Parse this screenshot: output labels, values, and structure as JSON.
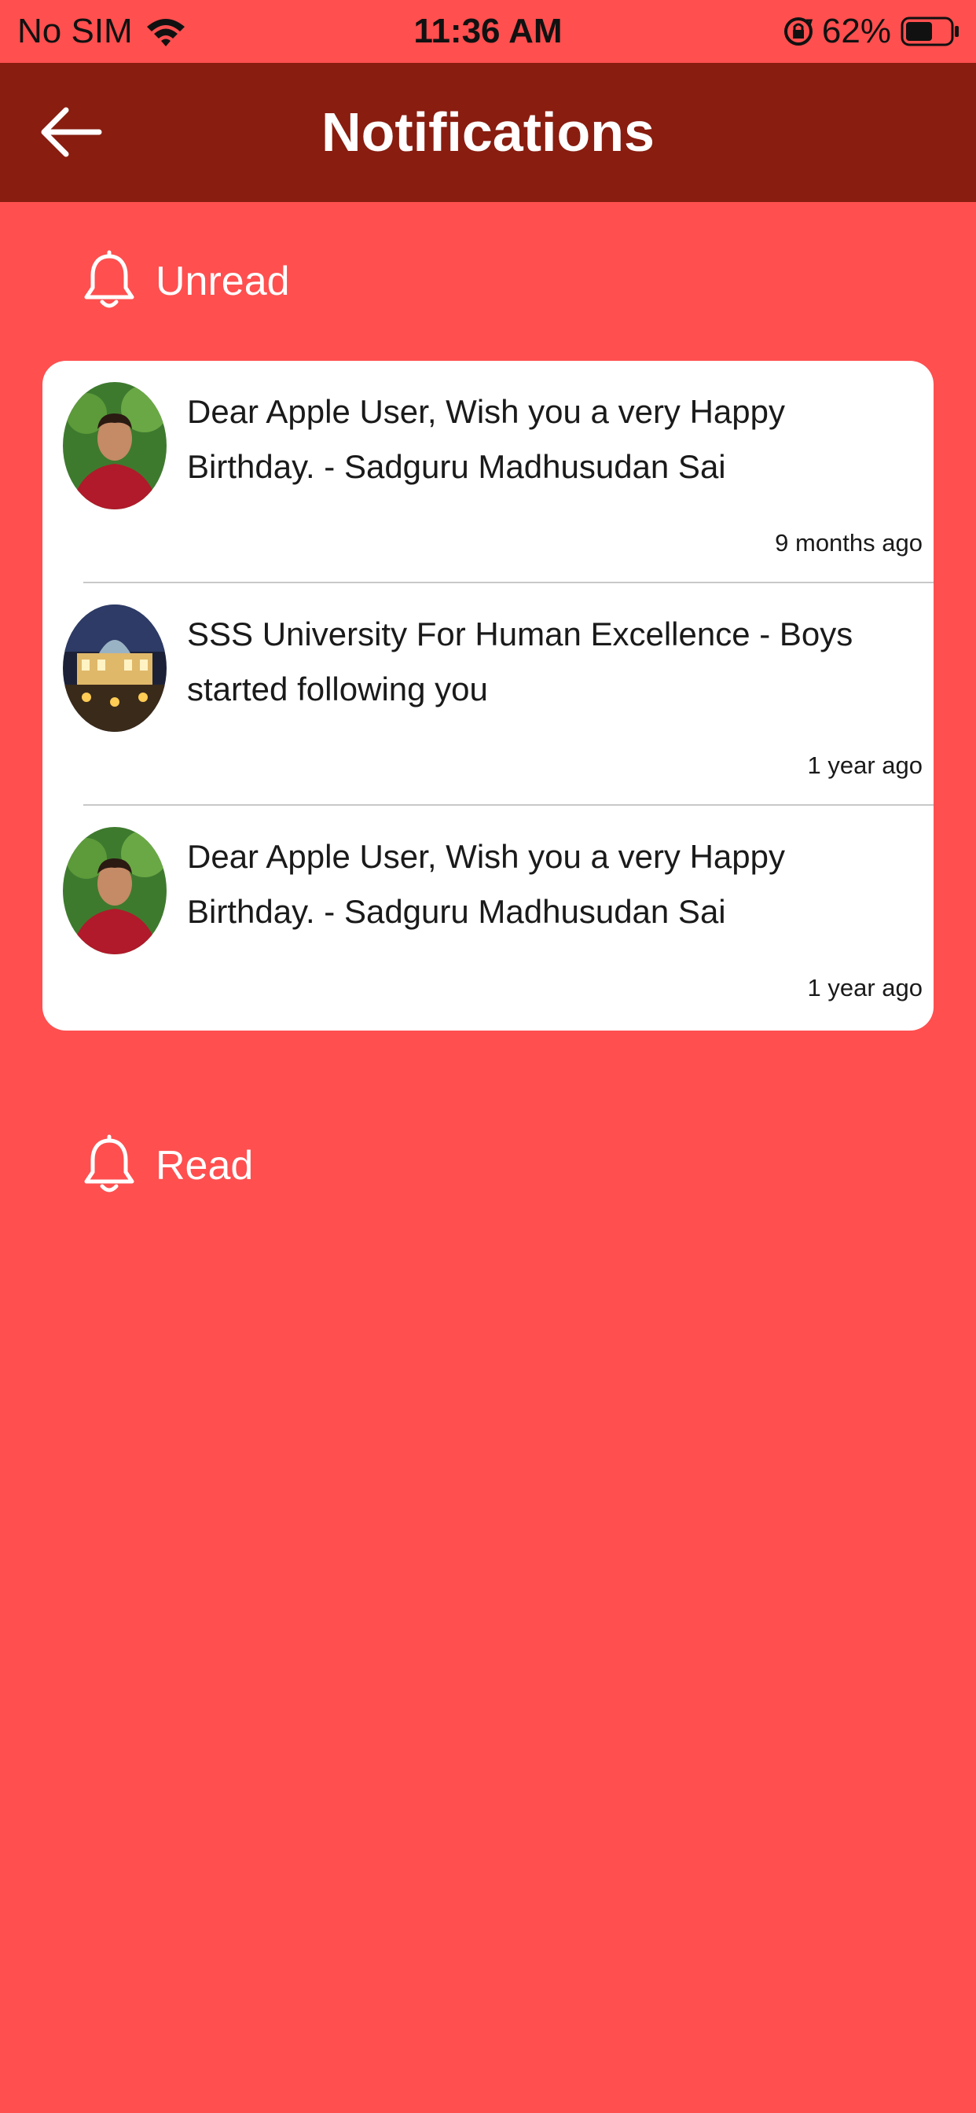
{
  "status_bar": {
    "carrier": "No SIM",
    "time": "11:36 AM",
    "battery_percent": "62%",
    "battery_level": 0.62,
    "wifi_icon": "wifi-icon",
    "orientation_lock_icon": "orientation-lock-icon"
  },
  "header": {
    "title": "Notifications",
    "back_icon": "arrow-left-icon"
  },
  "sections": {
    "unread": {
      "label": "Unread",
      "icon": "bell-icon"
    },
    "read": {
      "label": "Read",
      "icon": "bell-icon"
    }
  },
  "notifications": [
    {
      "message": "Dear Apple User, Wish you a very Happy Birthday. - Sadguru Madhusudan Sai",
      "time": "9 months ago",
      "avatar": "person-avatar"
    },
    {
      "message": "SSS University For Human Excellence - Boys started following you",
      "time": "1 year ago",
      "avatar": "building-avatar"
    },
    {
      "message": "Dear Apple User, Wish you a very Happy Birthday. - Sadguru Madhusudan Sai",
      "time": "1 year ago",
      "avatar": "person-avatar"
    }
  ],
  "colors": {
    "background": "#FF4F4F",
    "header": "#881D10",
    "card": "#FFFFFF",
    "text": "#1A1A1A"
  }
}
